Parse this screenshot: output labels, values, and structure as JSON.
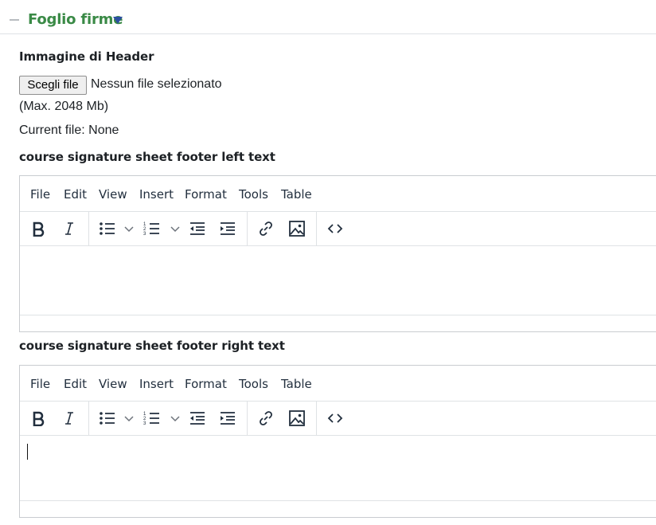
{
  "section": {
    "title": "Foglio firme"
  },
  "header_image": {
    "label": "Immagine di Header",
    "button_label": "Scegli file",
    "file_status": "Nessun file selezionato",
    "max_size": "(Max. 2048 Mb)",
    "current_file": "Current file: None"
  },
  "editor_left": {
    "label": "course signature sheet footer left text",
    "menu": [
      "File",
      "Edit",
      "View",
      "Insert",
      "Format",
      "Tools",
      "Table"
    ]
  },
  "editor_right": {
    "label": "course signature sheet footer right text",
    "menu": [
      "File",
      "Edit",
      "View",
      "Insert",
      "Format",
      "Tools",
      "Table"
    ]
  },
  "toolbar_icons": [
    "bold-icon",
    "italic-icon",
    "bullet-list-icon",
    "numbered-list-icon",
    "outdent-icon",
    "indent-icon",
    "link-icon",
    "image-icon",
    "source-code-icon"
  ]
}
